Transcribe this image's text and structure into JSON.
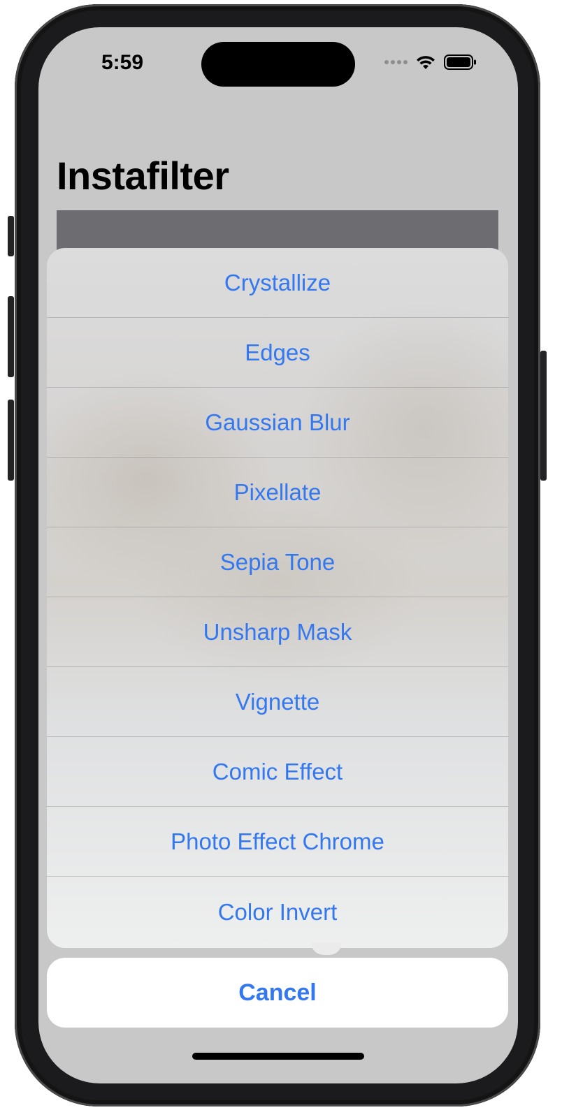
{
  "status_bar": {
    "time": "5:59",
    "icons": [
      "signal-dots-icon",
      "wifi-icon",
      "battery-icon"
    ]
  },
  "nav": {
    "title": "Instafilter"
  },
  "action_sheet": {
    "items": [
      {
        "label": "Crystallize"
      },
      {
        "label": "Edges"
      },
      {
        "label": "Gaussian Blur"
      },
      {
        "label": "Pixellate"
      },
      {
        "label": "Sepia Tone"
      },
      {
        "label": "Unsharp Mask"
      },
      {
        "label": "Vignette"
      },
      {
        "label": "Comic Effect"
      },
      {
        "label": "Photo Effect Chrome"
      },
      {
        "label": "Color Invert"
      }
    ],
    "cancel_label": "Cancel"
  },
  "colors": {
    "accent": "#3478f0",
    "screen_background": "#c8c8c9",
    "image_placeholder": "#6d6c71"
  }
}
